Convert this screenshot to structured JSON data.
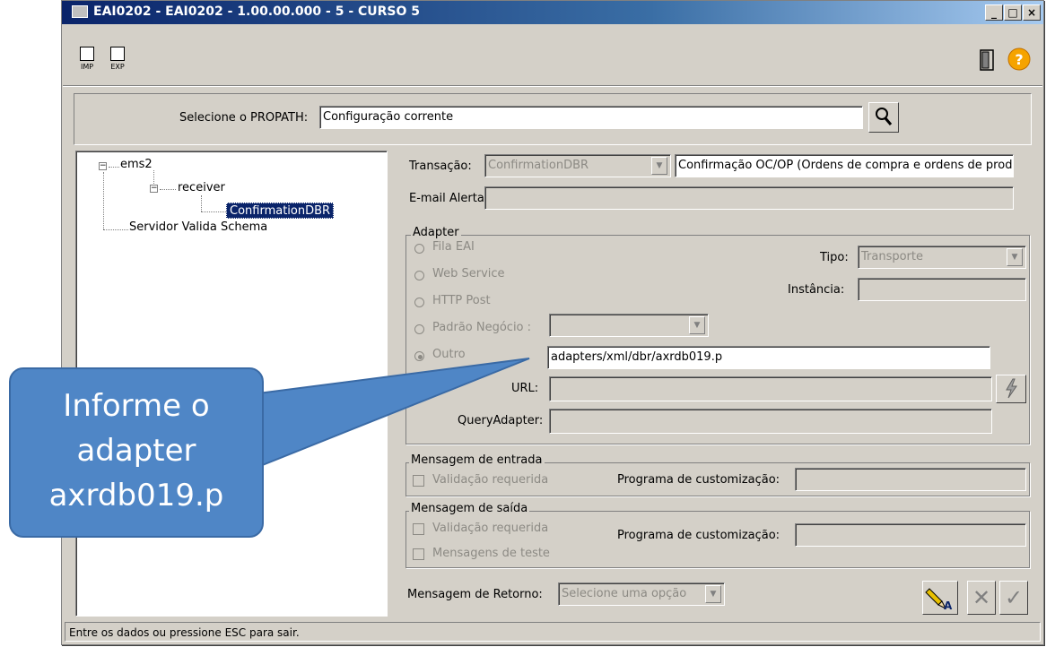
{
  "window": {
    "title": "EAI0202 - EAI0202 - 1.00.00.000 - 5 - CURSO 5",
    "controls": [
      "_",
      "□",
      "×"
    ]
  },
  "toolbar": {
    "imp_label": "IMP",
    "exp_label": "EXP"
  },
  "propath": {
    "label": "Selecione o PROPATH:",
    "value": "Configuração corrente"
  },
  "tree": {
    "items": [
      {
        "label": "ems2"
      },
      {
        "label": "receiver"
      },
      {
        "label": "ConfirmationDBR"
      },
      {
        "label": "Servidor Valida Schema"
      }
    ]
  },
  "form": {
    "transacao_label": "Transação:",
    "transacao_value": "ConfirmationDBR",
    "transacao_desc": "Confirmação OC/OP (Ordens de compra e ordens de prod",
    "email_label": "E-mail Alerta:",
    "email_value": "",
    "adapter": {
      "title": "Adapter",
      "options": [
        "Fila EAI",
        "Web Service",
        "HTTP Post",
        "Padrão Negócio :",
        "Outro"
      ],
      "selected": "Outro",
      "tipo_label": "Tipo:",
      "tipo_value": "Transporte",
      "instancia_label": "Instância:",
      "outro_value": "adapters/xml/dbr/axrdb019.p",
      "url_label": "URL:",
      "url_value": "",
      "query_label": "QueryAdapter:",
      "query_value": ""
    },
    "entrada": {
      "title": "Mensagem de entrada",
      "validacao_label": "Validação requerida",
      "programa_label": "Programa de customização:"
    },
    "saida": {
      "title": "Mensagem de saída",
      "validacao_label": "Validação requerida",
      "teste_label": "Mensagens de teste",
      "programa_label": "Programa de customização:"
    },
    "retorno_label": "Mensagem de Retorno:",
    "retorno_value": "Selecione uma opção"
  },
  "status": {
    "text": "Entre os dados ou pressione ESC para sair."
  },
  "callout": {
    "line1": "Informe o",
    "line2": "adapter",
    "line3": "axrdb019.p"
  },
  "colors": {
    "title_bar": "#0a246a",
    "selection": "#0a246a",
    "callout": "#4f86c6",
    "help_icon": "#f5a300"
  }
}
